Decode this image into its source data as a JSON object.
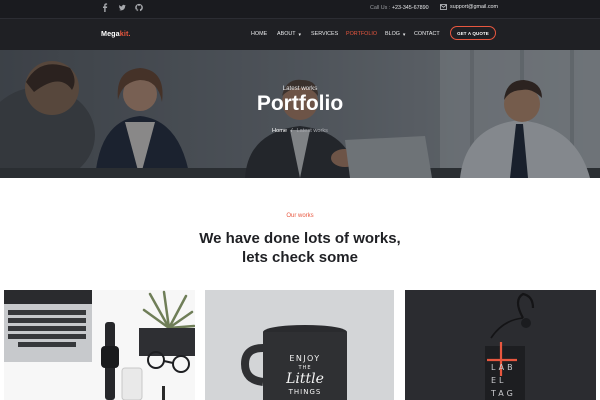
{
  "topbar": {
    "social": [
      "facebook-icon",
      "twitter-icon",
      "github-icon"
    ],
    "call_label": "Call Us :",
    "phone": "+23-345-67890",
    "email": "support@gmail.com"
  },
  "navbar": {
    "logo_main": "Mega",
    "logo_accent": "kit.",
    "items": [
      {
        "label": "HOME",
        "dropdown": false,
        "active": false
      },
      {
        "label": "ABOUT",
        "dropdown": true,
        "active": false
      },
      {
        "label": "SERVICES",
        "dropdown": false,
        "active": false
      },
      {
        "label": "PORTFOLIO",
        "dropdown": false,
        "active": true
      },
      {
        "label": "BLOG",
        "dropdown": true,
        "active": false
      },
      {
        "label": "CONTACT",
        "dropdown": false,
        "active": false
      }
    ],
    "cta": "GET A QUOTE"
  },
  "hero": {
    "kicker": "Latest works",
    "title": "Portfolio",
    "breadcrumb": {
      "home": "Home",
      "separator": "/",
      "current": "Latest works"
    }
  },
  "works": {
    "eyebrow": "Our works",
    "heading_line1": "We have done lots of works,",
    "heading_line2": "lets check some"
  },
  "portfolio_cards": [
    {
      "image": "workspace-photo"
    },
    {
      "image": "mug-photo",
      "mug_text": [
        "ENJOY",
        "THE",
        "Little",
        "THINGS"
      ]
    },
    {
      "image": "label-tag-photo",
      "tag_text": [
        "LAB",
        "EL",
        "TAG"
      ]
    }
  ],
  "colors": {
    "accent": "#e8573f",
    "dark": "#1f2024",
    "topbar": "#1a1b1f"
  }
}
